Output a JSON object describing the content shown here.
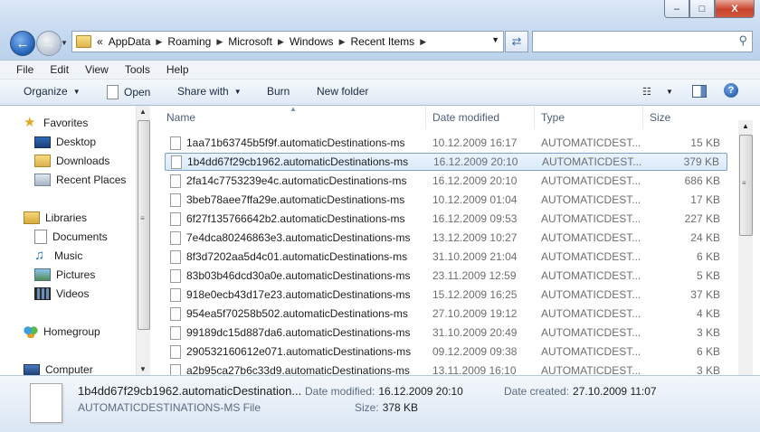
{
  "window": {
    "controls": {
      "minimize": "–",
      "maximize": "□",
      "close": "X"
    }
  },
  "address": {
    "overflow": "«",
    "crumbs": [
      "AppData",
      "Roaming",
      "Microsoft",
      "Windows",
      "Recent Items"
    ]
  },
  "menu": [
    "File",
    "Edit",
    "View",
    "Tools",
    "Help"
  ],
  "toolbar": {
    "organize": "Organize",
    "open": "Open",
    "share_with": "Share with",
    "burn": "Burn",
    "new_folder": "New folder"
  },
  "nav": {
    "favorites": "Favorites",
    "desktop": "Desktop",
    "downloads": "Downloads",
    "recent_places": "Recent Places",
    "libraries": "Libraries",
    "documents": "Documents",
    "music": "Music",
    "pictures": "Pictures",
    "videos": "Videos",
    "homegroup": "Homegroup",
    "computer": "Computer"
  },
  "columns": {
    "name": "Name",
    "date": "Date modified",
    "type": "Type",
    "size": "Size"
  },
  "files": [
    {
      "name": "1aa71b63745b5f9f.automaticDestinations-ms",
      "date": "10.12.2009 16:17",
      "type": "AUTOMATICDEST...",
      "size": "15 KB"
    },
    {
      "name": "1b4dd67f29cb1962.automaticDestinations-ms",
      "date": "16.12.2009 20:10",
      "type": "AUTOMATICDEST...",
      "size": "379 KB"
    },
    {
      "name": "2fa14c7753239e4c.automaticDestinations-ms",
      "date": "16.12.2009 20:10",
      "type": "AUTOMATICDEST...",
      "size": "686 KB"
    },
    {
      "name": "3beb78aee7ffa29e.automaticDestinations-ms",
      "date": "10.12.2009 01:04",
      "type": "AUTOMATICDEST...",
      "size": "17 KB"
    },
    {
      "name": "6f27f135766642b2.automaticDestinations-ms",
      "date": "16.12.2009 09:53",
      "type": "AUTOMATICDEST...",
      "size": "227 KB"
    },
    {
      "name": "7e4dca80246863e3.automaticDestinations-ms",
      "date": "13.12.2009 10:27",
      "type": "AUTOMATICDEST...",
      "size": "24 KB"
    },
    {
      "name": "8f3d7202aa5d4c01.automaticDestinations-ms",
      "date": "31.10.2009 21:04",
      "type": "AUTOMATICDEST...",
      "size": "6 KB"
    },
    {
      "name": "83b03b46dcd30a0e.automaticDestinations-ms",
      "date": "23.11.2009 12:59",
      "type": "AUTOMATICDEST...",
      "size": "5 KB"
    },
    {
      "name": "918e0ecb43d17e23.automaticDestinations-ms",
      "date": "15.12.2009 16:25",
      "type": "AUTOMATICDEST...",
      "size": "37 KB"
    },
    {
      "name": "954ea5f70258b502.automaticDestinations-ms",
      "date": "27.10.2009 19:12",
      "type": "AUTOMATICDEST...",
      "size": "4 KB"
    },
    {
      "name": "99189dc15d887da6.automaticDestinations-ms",
      "date": "31.10.2009 20:49",
      "type": "AUTOMATICDEST...",
      "size": "3 KB"
    },
    {
      "name": "290532160612e071.automaticDestinations-ms",
      "date": "09.12.2009 09:38",
      "type": "AUTOMATICDEST...",
      "size": "6 KB"
    },
    {
      "name": "a2b95ca27b6c33d9.automaticDestinations-ms",
      "date": "13.11.2009 16:10",
      "type": "AUTOMATICDEST...",
      "size": "3 KB"
    }
  ],
  "selected_index": 1,
  "details": {
    "file_name": "1b4dd67f29cb1962.automaticDestination...",
    "file_type": "AUTOMATICDESTINATIONS-MS File",
    "date_modified_label": "Date modified:",
    "date_modified": "16.12.2009 20:10",
    "date_created_label": "Date created:",
    "date_created": "27.10.2009 11:07",
    "size_label": "Size:",
    "size": "378 KB"
  }
}
